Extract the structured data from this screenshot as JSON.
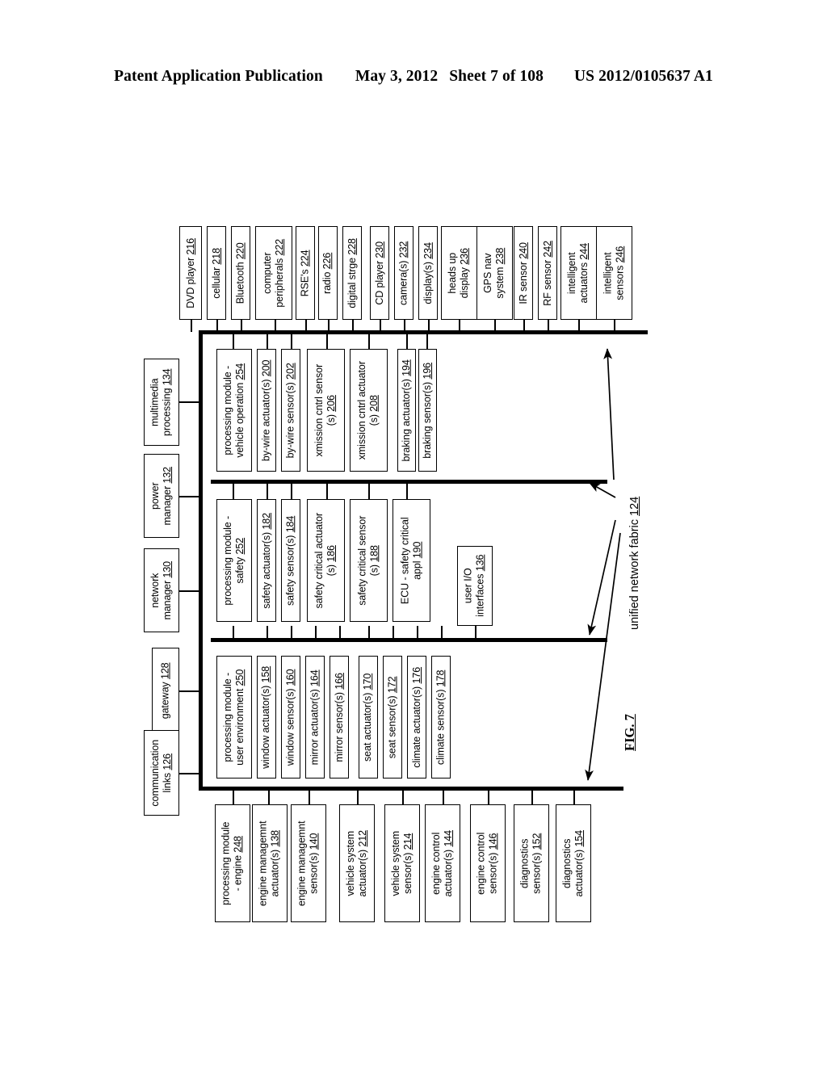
{
  "header": {
    "title": "Patent Application Publication",
    "date": "May 3, 2012",
    "sheet": "Sheet 7 of 108",
    "patent_number": "US 2012/0105637 A1"
  },
  "figure": {
    "caption": "FIG. 7",
    "fabric_label": "unified network fabric ",
    "fabric_ref": "124"
  },
  "top_row": [
    {
      "line1": "DVD player ",
      "line2": "",
      "ref": "216"
    },
    {
      "line1": "cellular ",
      "line2": "",
      "ref": "218"
    },
    {
      "line1": "Bluetooth ",
      "line2": "",
      "ref": "220"
    },
    {
      "line1": "computer",
      "line2": "peripherals ",
      "ref": "222"
    },
    {
      "line1": "RSE's ",
      "line2": "",
      "ref": "224"
    },
    {
      "line1": "radio ",
      "line2": "",
      "ref": "226"
    },
    {
      "line1": "digital strge ",
      "line2": "",
      "ref": "228"
    },
    {
      "line1": "CD player ",
      "line2": "",
      "ref": "230"
    },
    {
      "line1": "camera(s) ",
      "line2": "",
      "ref": "232"
    },
    {
      "line1": "display(s) ",
      "line2": "",
      "ref": "234"
    },
    {
      "line1": "heads up",
      "line2": "display ",
      "ref": "236"
    },
    {
      "line1": "GPS nav",
      "line2": "system ",
      "ref": "238"
    },
    {
      "line1": "IR sensor ",
      "line2": "",
      "ref": "240"
    },
    {
      "line1": "RF sensor ",
      "line2": "",
      "ref": "242"
    },
    {
      "line1": "intelligent",
      "line2": "actuators ",
      "ref": "244"
    },
    {
      "line1": "intelligent",
      "line2": "sensors ",
      "ref": "246"
    }
  ],
  "left_column": [
    {
      "line1": "multimedia",
      "line2": "processing ",
      "ref": "134"
    },
    {
      "line1": "power",
      "line2": "manager ",
      "ref": "132"
    },
    {
      "line1": "network",
      "line2": "manager ",
      "ref": "130"
    },
    {
      "line1": "gateway ",
      "line2": "",
      "ref": "128"
    },
    {
      "line1": "communication",
      "line2": "links ",
      "ref": "126"
    }
  ],
  "vehicle_operation_group": [
    {
      "line1": "processing module -",
      "line2": "vehicle operation ",
      "ref": "254"
    },
    {
      "line1": "by-wire actuator(s) ",
      "line2": "",
      "ref": "200"
    },
    {
      "line1": "by-wire sensor(s) ",
      "line2": "",
      "ref": "202"
    },
    {
      "line1": "xmission cntrl sensor",
      "line2": "(s) ",
      "ref": "206"
    },
    {
      "line1": "xmission cntrl actuator",
      "line2": "(s) ",
      "ref": "208"
    },
    {
      "line1": "braking actuator(s) ",
      "line2": "",
      "ref": "194"
    },
    {
      "line1": "braking sensor(s) ",
      "line2": "",
      "ref": "196"
    }
  ],
  "safety_group": [
    {
      "line1": "processing module -",
      "line2": "safety ",
      "ref": "252"
    },
    {
      "line1": "safety actuator(s) ",
      "line2": "",
      "ref": "182"
    },
    {
      "line1": "safety sensor(s) ",
      "line2": "",
      "ref": "184"
    },
    {
      "line1": "safety critical actuator",
      "line2": "(s) ",
      "ref": "186"
    },
    {
      "line1": "safety critical sensor",
      "line2": "(s) ",
      "ref": "188"
    },
    {
      "line1": "ECU - safety critical",
      "line2": "appl ",
      "ref": "190"
    }
  ],
  "user_io": {
    "line1": "user I/O",
    "line2": "interfaces ",
    "ref": "136"
  },
  "user_environment_group": [
    {
      "line1": "processing module -",
      "line2": "user environment ",
      "ref": "250"
    },
    {
      "line1": "window actuator(s) ",
      "line2": "",
      "ref": "158"
    },
    {
      "line1": "window sensor(s) ",
      "line2": "",
      "ref": "160"
    },
    {
      "line1": "mirror actuator(s) ",
      "line2": "",
      "ref": "164"
    },
    {
      "line1": "mirror sensor(s) ",
      "line2": "",
      "ref": "166"
    },
    {
      "line1": "seat actuator(s) ",
      "line2": "",
      "ref": "170"
    },
    {
      "line1": "seat sensor(s) ",
      "line2": "",
      "ref": "172"
    },
    {
      "line1": "climate actuator(s) ",
      "line2": "",
      "ref": "176"
    },
    {
      "line1": "climate sensor(s) ",
      "line2": "",
      "ref": "178"
    }
  ],
  "engine_group": [
    {
      "line1": "processing module",
      "line2": "- engine ",
      "ref": "248"
    },
    {
      "line1": "engine managemnt",
      "line2": "actuator(s) ",
      "ref": "138"
    },
    {
      "line1": "engine managemnt",
      "line2": "sensor(s) ",
      "ref": "140"
    },
    {
      "line1": "vehicle system",
      "line2": "actuator(s) ",
      "ref": "212"
    },
    {
      "line1": "vehicle system",
      "line2": "sensor(s) ",
      "ref": "214"
    },
    {
      "line1": "engine control",
      "line2": "actuator(s) ",
      "ref": "144"
    },
    {
      "line1": "engine control",
      "line2": "sensor(s) ",
      "ref": "146"
    },
    {
      "line1": "diagnostics",
      "line2": "sensor(s) ",
      "ref": "152"
    },
    {
      "line1": "diagnostics",
      "line2": "actuator(s) ",
      "ref": "154"
    }
  ]
}
